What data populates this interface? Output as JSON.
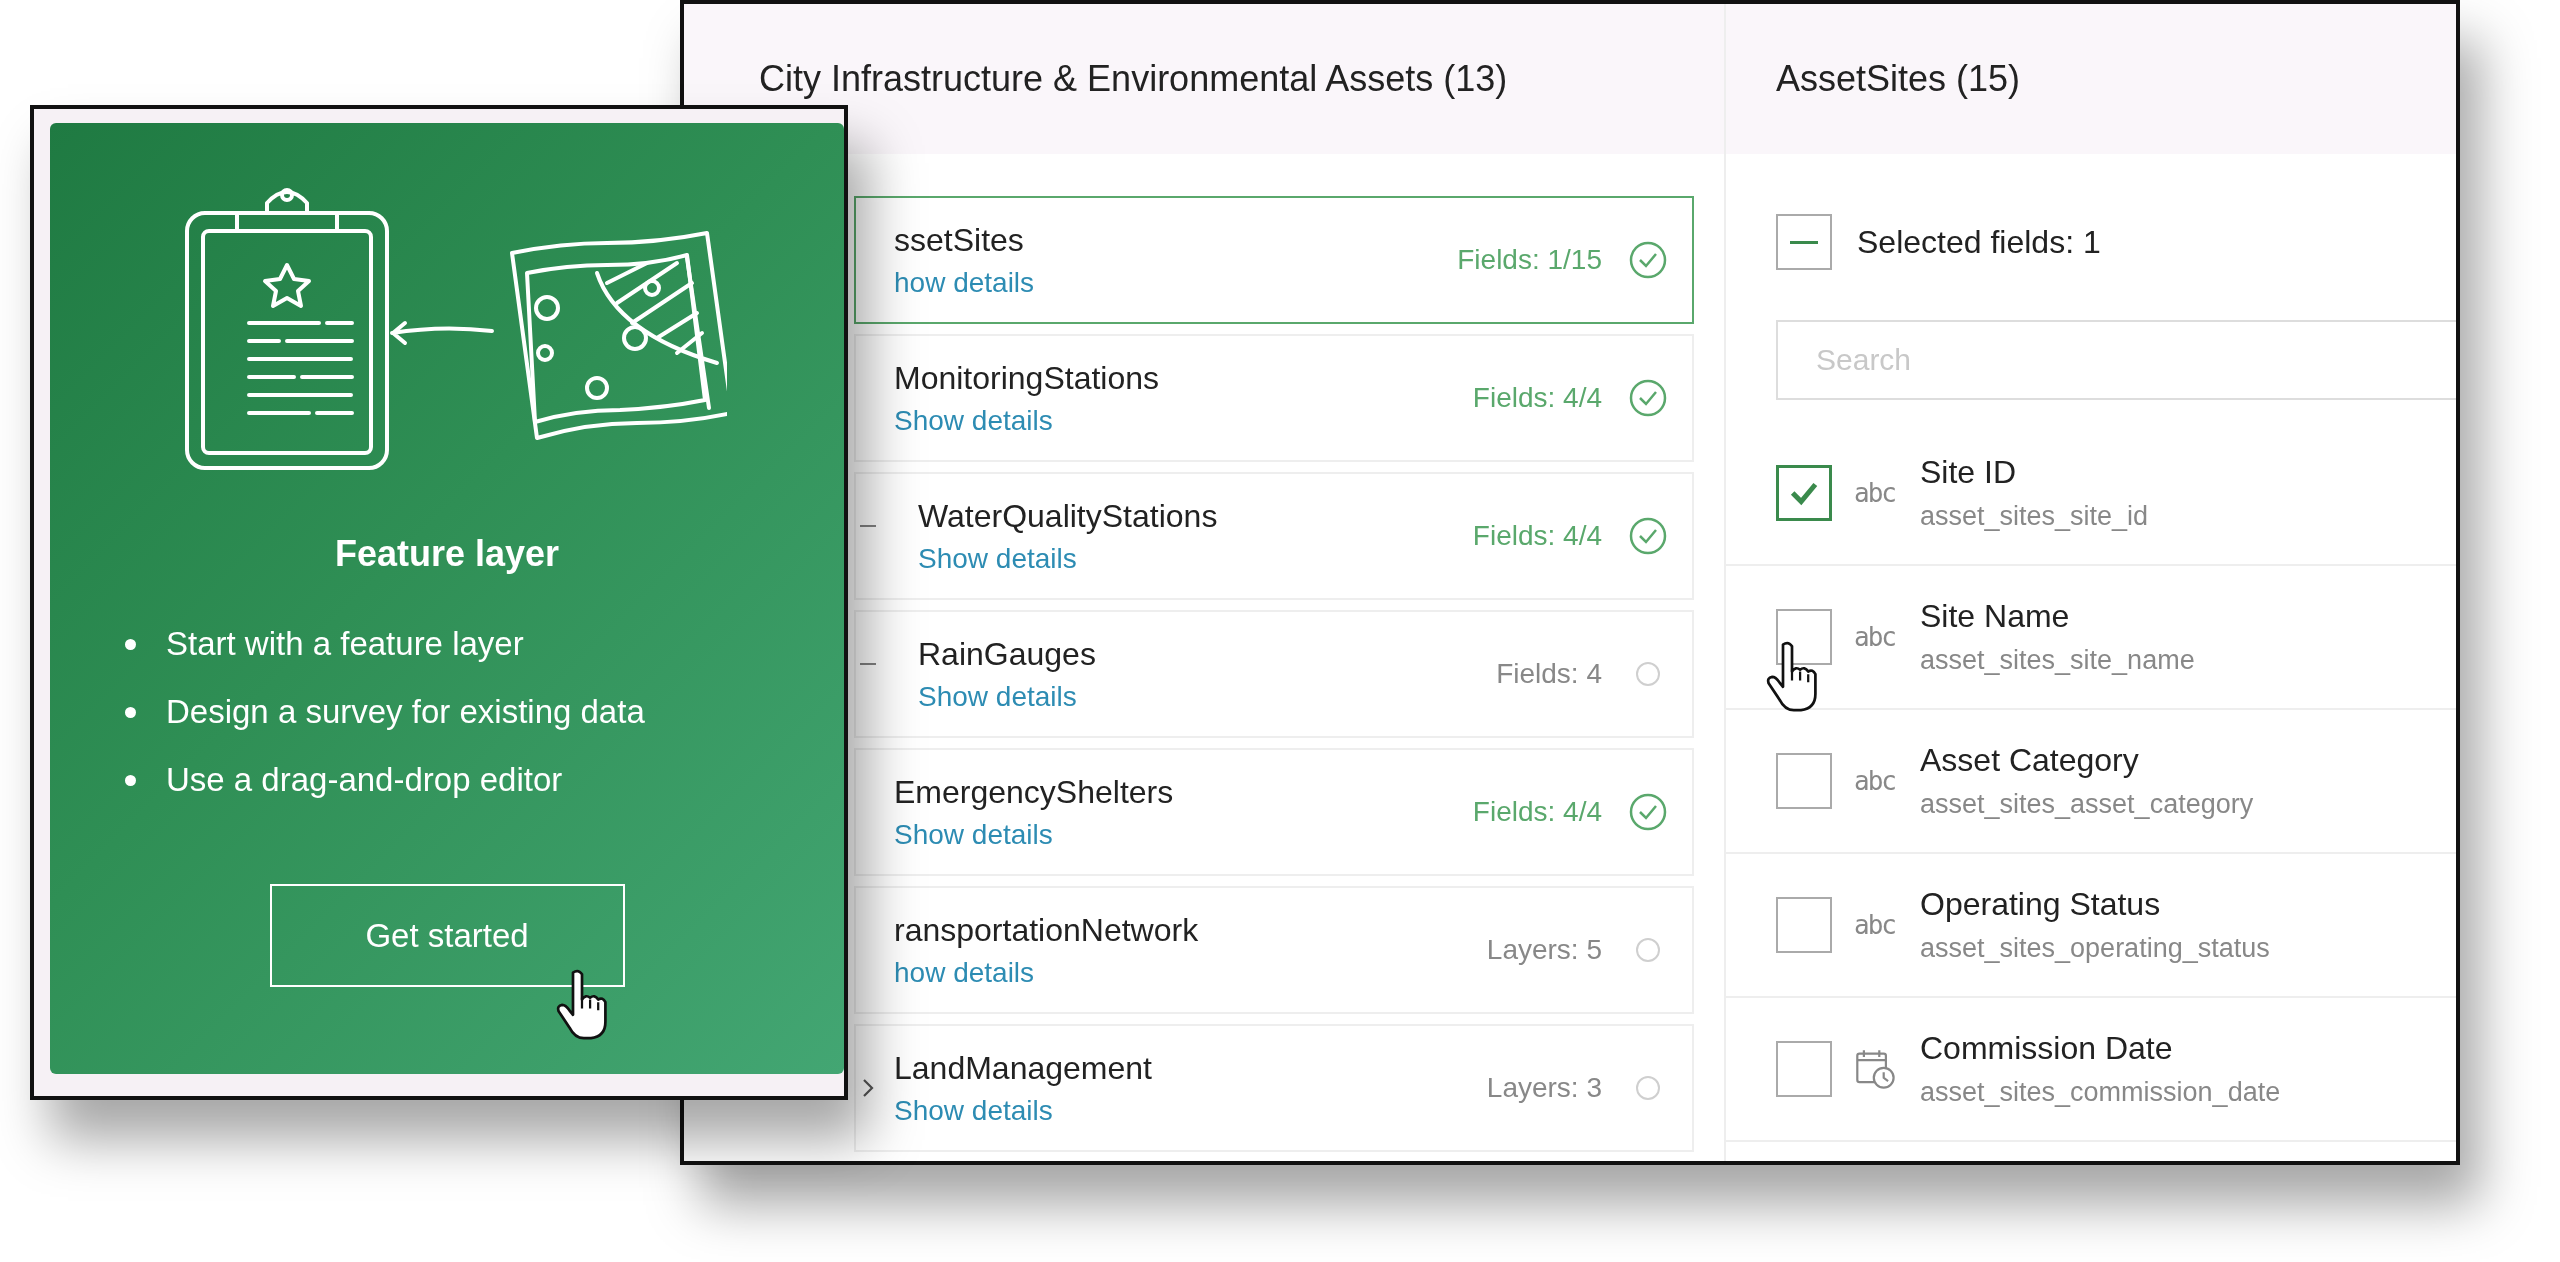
{
  "card": {
    "title": "Feature layer",
    "bullets": [
      "Start with a feature layer",
      "Design a survey for existing data",
      "Use a drag-and-drop editor"
    ],
    "button": "Get started"
  },
  "layers_panel": {
    "title": "City Infrastructure & Environmental Assets (13)",
    "items": [
      {
        "name": "ssetSites",
        "details": "how details",
        "count": "Fields: 1/15",
        "complete": true,
        "selected": true,
        "kind": "leaf"
      },
      {
        "name": "MonitoringStations",
        "details": "Show details",
        "count": "Fields: 4/4",
        "complete": true,
        "selected": false,
        "kind": "leaf"
      },
      {
        "name": "WaterQualityStations",
        "details": "Show details",
        "count": "Fields: 4/4",
        "complete": true,
        "selected": false,
        "kind": "nested"
      },
      {
        "name": "RainGauges",
        "details": "Show details",
        "count": "Fields: 4",
        "complete": false,
        "selected": false,
        "kind": "nested"
      },
      {
        "name": "EmergencyShelters",
        "details": "Show details",
        "count": "Fields: 4/4",
        "complete": true,
        "selected": false,
        "kind": "leaf"
      },
      {
        "name": "ransportationNetwork",
        "details": "how details",
        "count": "Layers: 5",
        "complete": false,
        "selected": false,
        "kind": "leaf"
      },
      {
        "name": "LandManagement",
        "details": "Show details",
        "count": "Layers: 3",
        "complete": false,
        "selected": false,
        "kind": "group",
        "expanded": false
      }
    ]
  },
  "fields_panel": {
    "title": "AssetSites (15)",
    "select_all": {
      "label": "Selected fields: 1",
      "indeterminate": true
    },
    "search": {
      "placeholder": "Search"
    },
    "fields": [
      {
        "label": "Site ID",
        "name": "asset_sites_site_id",
        "kind": "text",
        "type_label": "abc",
        "checked": true
      },
      {
        "label": "Site Name",
        "name": "asset_sites_site_name",
        "kind": "text",
        "type_label": "abc",
        "checked": false
      },
      {
        "label": "Asset Category",
        "name": "asset_sites_asset_category",
        "kind": "text",
        "type_label": "abc",
        "checked": false
      },
      {
        "label": "Operating Status",
        "name": "asset_sites_operating_status",
        "kind": "text",
        "type_label": "abc",
        "checked": false
      },
      {
        "label": "Commission Date",
        "name": "asset_sites_commission_date",
        "kind": "date",
        "checked": false
      }
    ]
  }
}
